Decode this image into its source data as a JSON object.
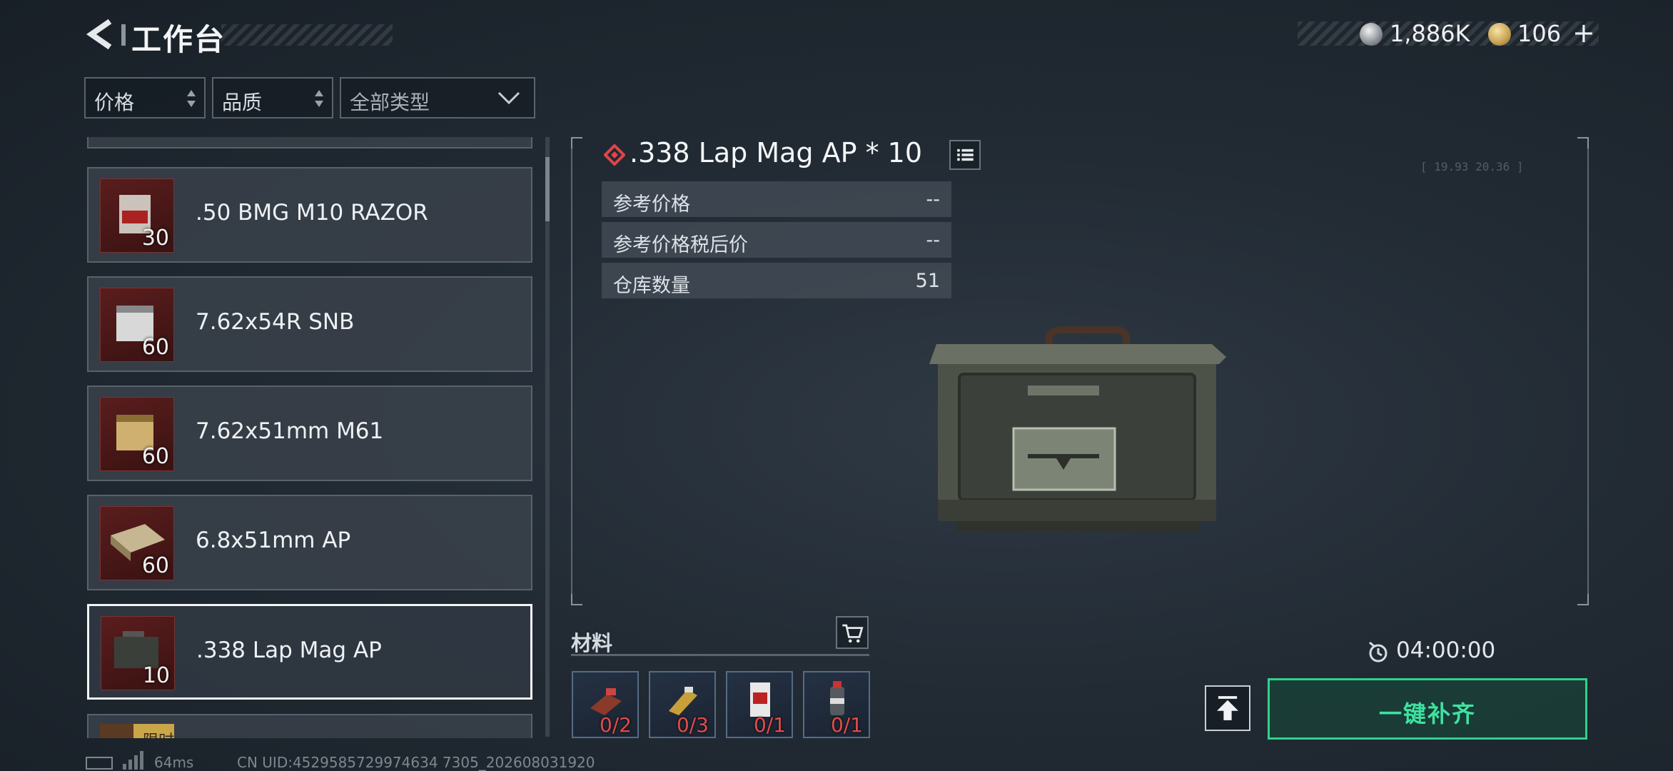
{
  "header": {
    "title": "工作台",
    "currency_primary": "1,886K",
    "currency_secondary": "106",
    "add_symbol": "+"
  },
  "filters": {
    "price": "价格",
    "quality": "品质",
    "type": "全部类型"
  },
  "list": {
    "items": [
      {
        "name": ".50 BMG M10 RAZOR",
        "qty": "30",
        "selected": false
      },
      {
        "name": "7.62x54R SNB",
        "qty": "60",
        "selected": false
      },
      {
        "name": "7.62x51mm M61",
        "qty": "60",
        "selected": false
      },
      {
        "name": "6.8x51mm AP",
        "qty": "60",
        "selected": false
      },
      {
        "name": ".338 Lap Mag AP",
        "qty": "10",
        "selected": true
      }
    ],
    "partial_tag": "限时"
  },
  "detail": {
    "title": ".338 Lap Mag AP * 10",
    "rows": [
      {
        "label": "参考价格",
        "value": "--"
      },
      {
        "label": "参考价格税后价",
        "value": "--"
      },
      {
        "label": "仓库数量",
        "value": "51"
      }
    ],
    "deco_numbers": "[ 19.93    20.36 ]"
  },
  "materials": {
    "label": "材料",
    "slots": [
      {
        "count": "0/2"
      },
      {
        "count": "0/3"
      },
      {
        "count": "0/1"
      },
      {
        "count": "0/1"
      }
    ]
  },
  "craft": {
    "time": "04:00:00",
    "fill_label": "一键补齐"
  },
  "footer": {
    "ping": "64ms",
    "uid": "CN UID:4529585729974634 7305_202608031920"
  },
  "colors": {
    "accent_green": "#2ed38a",
    "missing_red": "#e24b4b",
    "item_bg_red": "#5a1d1d"
  },
  "icons": [
    "back-icon",
    "currency-silver-icon",
    "currency-gold-icon",
    "sort-icon",
    "chevron-down-icon",
    "diamond-icon",
    "list-icon",
    "cart-icon",
    "clock-icon",
    "upload-icon"
  ]
}
